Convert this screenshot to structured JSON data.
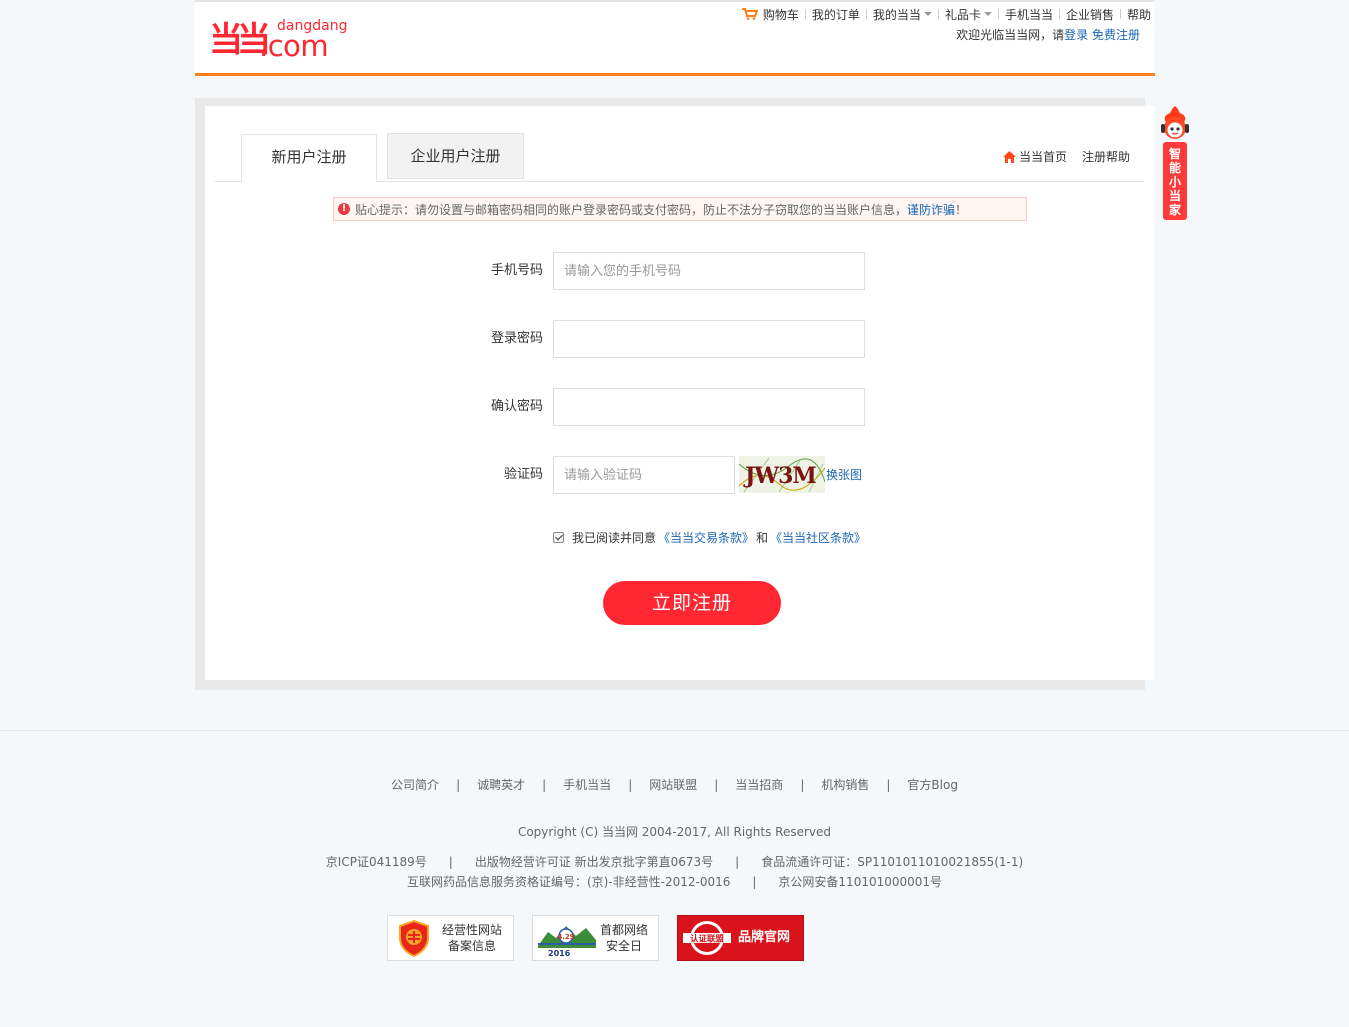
{
  "header": {
    "logo": {
      "mark": "当当",
      "subtitle": "dangdang",
      "domain": ".com"
    },
    "nav": [
      {
        "label": "购物车",
        "icon": "cart-icon",
        "dropdown": false
      },
      {
        "label": "我的订单",
        "dropdown": false
      },
      {
        "label": "我的当当",
        "dropdown": true
      },
      {
        "label": "礼品卡",
        "dropdown": true
      },
      {
        "label": "手机当当",
        "dropdown": false
      },
      {
        "label": "企业销售",
        "dropdown": false
      },
      {
        "label": "帮助",
        "dropdown": false
      }
    ],
    "welcome": {
      "prefix": "欢迎光临当当网，请",
      "login": "登录",
      "register": "免费注册"
    }
  },
  "tabs": {
    "new_user": "新用户注册",
    "corp_user": "企业用户注册",
    "home_link": "当当首页",
    "help_link": "注册帮助"
  },
  "tip": {
    "text": "贴心提示：请勿设置与邮箱密码相同的账户登录密码或支付密码，防止不法分子窃取您的当当账户信息，",
    "link": "谨防诈骗",
    "suffix": "！"
  },
  "form": {
    "phone": {
      "label": "手机号码",
      "placeholder": "请输入您的手机号码",
      "value": ""
    },
    "password": {
      "label": "登录密码",
      "placeholder": "",
      "value": ""
    },
    "confirm": {
      "label": "确认密码",
      "placeholder": "",
      "value": ""
    },
    "captcha": {
      "label": "验证码",
      "placeholder": "请输入验证码",
      "value": "",
      "image_text": "JW3M",
      "refresh": "换张图"
    },
    "agree": {
      "checked": true,
      "text": "我已阅读并同意",
      "terms1": "《当当交易条款》",
      "and": "和",
      "terms2": "《当当社区条款》"
    },
    "submit": "立即注册"
  },
  "assistant": {
    "label": "智能小当家"
  },
  "footer": {
    "links": [
      "公司简介",
      "诚聘英才",
      "手机当当",
      "网站联盟",
      "当当招商",
      "机构销售",
      "官方Blog"
    ],
    "copyright": "Copyright (C) 当当网 2004-2017, All Rights Reserved",
    "licenses1": [
      "京ICP证041189号",
      "出版物经营许可证 新出发京批字第直0673号",
      "食品流通许可证：SP1101011010021855(1-1)"
    ],
    "licenses2": [
      "互联网药品信息服务资格证编号：(京)-非经营性-2012-0016",
      "京公网安备110101000001号"
    ],
    "badges": {
      "record": {
        "line1": "经营性网站",
        "line2": "备案信息"
      },
      "security": {
        "line1": "首都网络",
        "line2": "安全日",
        "year": "2016",
        "date": "4.29"
      },
      "brand": {
        "seal": "认证联盟",
        "label": "品牌官网"
      }
    }
  },
  "colors": {
    "brand_red": "#ff2832",
    "header_orange": "#ff7e1a",
    "link_blue": "#1a66b3"
  }
}
